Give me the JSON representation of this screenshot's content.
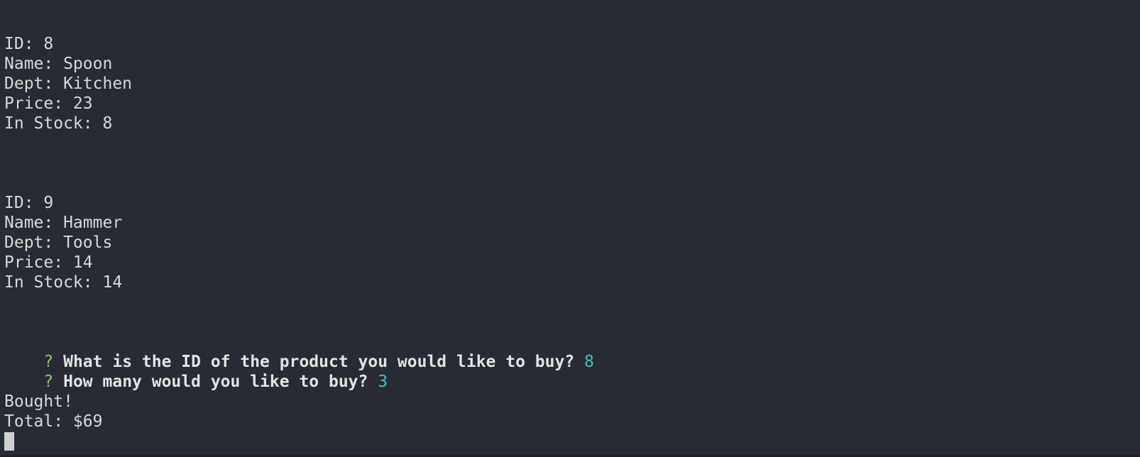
{
  "products": [
    {
      "id_line": "ID: 8",
      "name_line": "Name: Spoon",
      "dept_line": "Dept: Kitchen",
      "price_line": "Price: 23",
      "stock_line": "In Stock: 8"
    },
    {
      "id_line": "ID: 9",
      "name_line": "Name: Hammer",
      "dept_line": "Dept: Tools",
      "price_line": "Price: 14",
      "stock_line": "In Stock: 14"
    }
  ],
  "prompts": [
    {
      "mark": "?",
      "question": "What is the ID of the product you would like to buy?",
      "answer": "8"
    },
    {
      "mark": "?",
      "question": "How many would you like to buy?",
      "answer": "3"
    }
  ],
  "result": {
    "status": "Bought!",
    "total": "Total: $69"
  },
  "colors": {
    "background": "#272b34",
    "text": "#d8d8d8",
    "prompt_mark": "#8fc167",
    "answer": "#4fb8c6"
  }
}
